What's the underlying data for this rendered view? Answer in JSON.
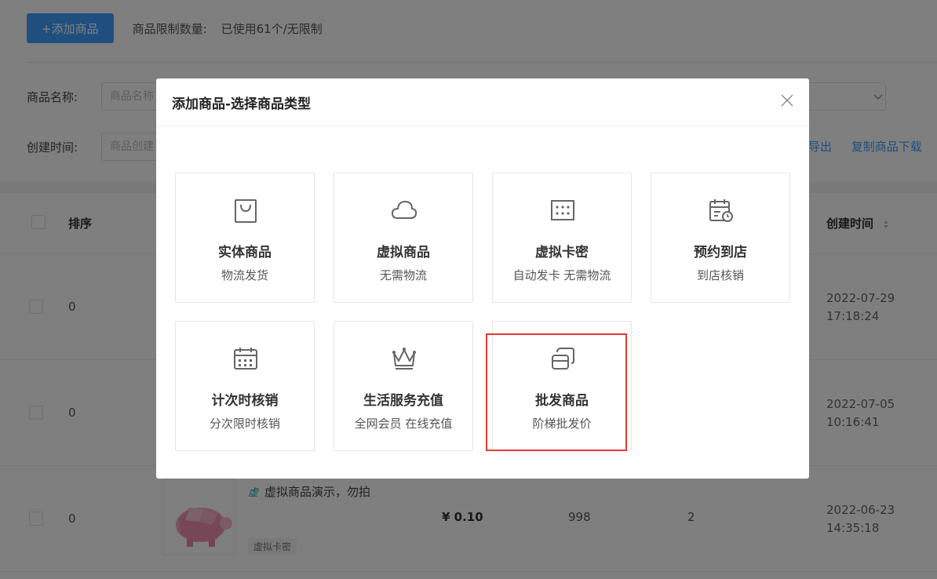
{
  "toolbar": {
    "add_button": "+添加商品",
    "limit_label": "商品限制数量:",
    "limit_value": "已使用61个/无限制"
  },
  "filters": {
    "name_label": "商品名称:",
    "name_placeholder": "商品名称",
    "time_label": "创建时间:",
    "time_placeholder": "商品创建"
  },
  "actions": {
    "export": "导出",
    "copy_download": "复制商品下载"
  },
  "table": {
    "headers": {
      "sort": "排序",
      "created": "创建时间"
    },
    "rows": [
      {
        "seq": "0",
        "created_date": "2022-07-29",
        "created_time": "17:18:24"
      },
      {
        "seq": "0",
        "created_date": "2022-07-05",
        "created_time": "10:16:41"
      },
      {
        "seq": "0",
        "created_date": "2022-06-23",
        "created_time": "14:35:18",
        "badge": "虚",
        "name": "虚拟商品演示，勿拍",
        "tag": "虚拟卡密",
        "price": "¥ 0.10",
        "stock": "998",
        "sales": "2"
      }
    ]
  },
  "dialog": {
    "title": "添加商品-选择商品类型",
    "cards": [
      {
        "title": "实体商品",
        "sub": "物流发货",
        "icon": "shopping-bag-icon"
      },
      {
        "title": "虚拟商品",
        "sub": "无需物流",
        "icon": "cloud-icon"
      },
      {
        "title": "虚拟卡密",
        "sub": "自动发卡 无需物流",
        "icon": "card-key-icon"
      },
      {
        "title": "预约到店",
        "sub": "到店核销",
        "icon": "calendar-clock-icon"
      },
      {
        "title": "计次时核销",
        "sub": "分次限时核销",
        "icon": "calendar-icon"
      },
      {
        "title": "生活服务充值",
        "sub": "全网会员 在线充值",
        "icon": "crown-icon"
      },
      {
        "title": "批发商品",
        "sub": "阶梯批发价",
        "icon": "boxes-icon"
      }
    ]
  },
  "colors": {
    "primary": "#409eff",
    "highlight": "#e53935",
    "overlay": "rgba(0,0,0,0.5)"
  }
}
